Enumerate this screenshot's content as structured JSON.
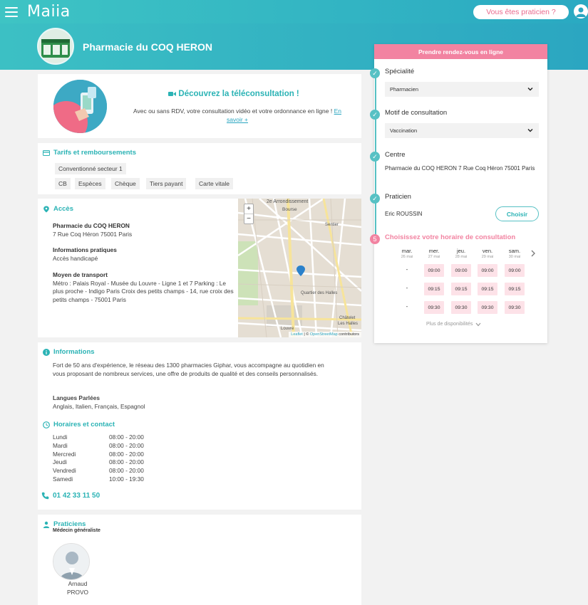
{
  "header": {
    "logo": "Maiia",
    "pro_button": "Vous êtes praticien ?"
  },
  "hero": {
    "title": "Pharmacie du COQ HERON"
  },
  "teleconsult": {
    "title": "Découvrez la téléconsultation !",
    "text": "Avec ou sans RDV, votre consultation vidéo et votre ordonnance en ligne !",
    "link": "En savoir +"
  },
  "tarifs": {
    "title": "Tarifs et remboursements",
    "sector": "Conventionné secteur 1",
    "payments": [
      "CB",
      "Espèces",
      "Chèque",
      "Tiers payant",
      "Carte vitale"
    ]
  },
  "acces": {
    "title": "Accès",
    "name": "Pharmacie du COQ HERON",
    "address": "7 Rue Coq Héron 75001 Paris",
    "info_label": "Informations pratiques",
    "info_value": "Accès handicapé",
    "transport_label": "Moyen de transport",
    "transport_value": "Métro : Palais Royal - Musée du Louvre - Ligne 1 et 7 Parking : Le plus proche - Indigo Paris Croix des petits champs - 14, rue croix des petits champs - 75001 Paris",
    "map": {
      "zoom_in": "+",
      "zoom_out": "−",
      "labels": [
        "2e Arrondissement",
        "Bourse",
        "Sentier",
        "Quartier des Halles",
        "Châtelet",
        "Les Halles",
        "Louvre"
      ],
      "attribution_leaflet": "Leaflet",
      "attribution_osm": "OpenStreetMap",
      "attribution_rest": "contributors"
    }
  },
  "informations": {
    "title": "Informations",
    "text": "Fort de 50 ans d'expérience, le réseau des 1300 pharmacies Giphar, vous accompagne au quotidien en vous proposant de nombreux services, une offre de produits de qualité et des conseils personnalisés.",
    "lang_label": "Langues Parlées",
    "lang_value": "Anglais, Italien, Français, Espagnol"
  },
  "horaires": {
    "title": "Horaires et contact",
    "days": [
      {
        "day": "Lundi",
        "hours": "08:00 - 20:00"
      },
      {
        "day": "Mardi",
        "hours": "08:00 - 20:00"
      },
      {
        "day": "Mercredi",
        "hours": "08:00 - 20:00"
      },
      {
        "day": "Jeudi",
        "hours": "08:00 - 20:00"
      },
      {
        "day": "Vendredi",
        "hours": "08:00 - 20:00"
      },
      {
        "day": "Samedi",
        "hours": "10:00 - 19:30"
      }
    ],
    "phone": "01 42 33 11 50"
  },
  "praticiens": {
    "title": "Praticiens",
    "subtitle": "Médecin généraliste",
    "first_name": "Arnaud",
    "last_name": "PROVO"
  },
  "booking": {
    "header": "Prendre rendez-vous en ligne",
    "specialite_label": "Spécialité",
    "specialite_value": "Pharmacien",
    "motif_label": "Motif de consultation",
    "motif_value": "Vaccination",
    "centre_label": "Centre",
    "centre_value": "Pharmacie du COQ HERON 7 Rue Coq Héron 75001 Paris",
    "praticien_label": "Praticien",
    "praticien_value": "Eric ROUSSIN",
    "choose_button": "Choisir",
    "step5_number": "5",
    "step5_label": "Choisissez votre horaire de consultation",
    "days": [
      {
        "day": "mar.",
        "date": "26 mai",
        "slots": [
          "-",
          "-",
          "-"
        ]
      },
      {
        "day": "mer.",
        "date": "27 mai",
        "slots": [
          "09:00",
          "09:15",
          "09:30"
        ]
      },
      {
        "day": "jeu.",
        "date": "28 mai",
        "slots": [
          "09:00",
          "09:15",
          "09:30"
        ]
      },
      {
        "day": "ven.",
        "date": "29 mai",
        "slots": [
          "09:00",
          "09:15",
          "09:30"
        ]
      },
      {
        "day": "sam.",
        "date": "30 mai",
        "slots": [
          "09:00",
          "09:15",
          "09:30"
        ]
      }
    ],
    "more": "Plus de disponibilités"
  },
  "colors": {
    "teal": "#2bb3b5",
    "pink": "#f283a1",
    "slot_bg": "#fde2e8"
  }
}
